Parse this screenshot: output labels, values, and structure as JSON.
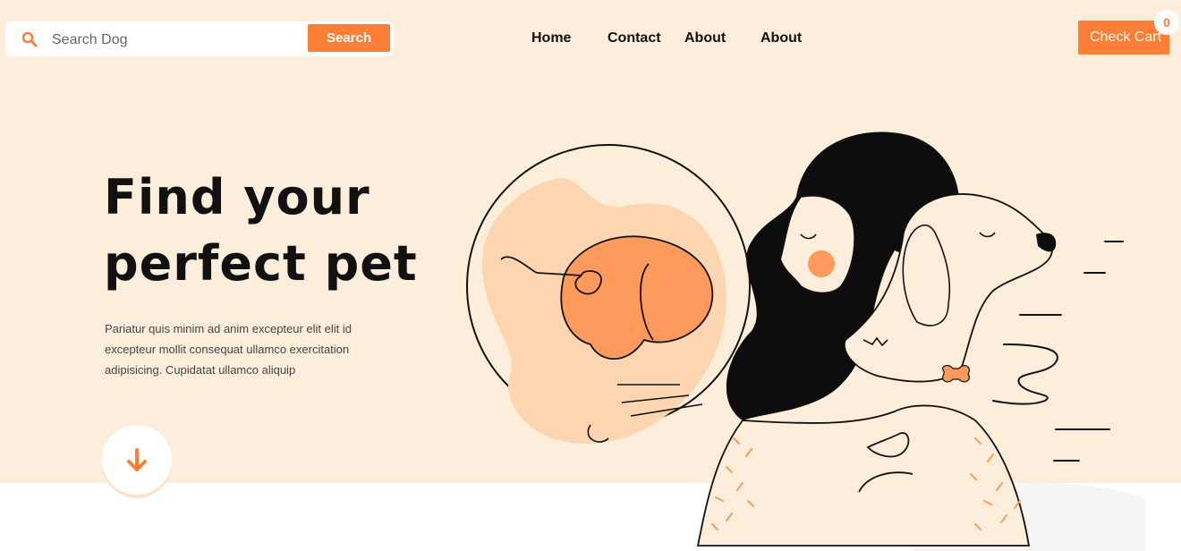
{
  "header": {
    "search": {
      "placeholder": "Search Dog",
      "button_label": "Search",
      "icon": "search-icon"
    },
    "nav": [
      {
        "label": "Home"
      },
      {
        "label": "Contact"
      },
      {
        "label": "About"
      },
      {
        "label": "About"
      }
    ],
    "cart": {
      "label": "Check Cart",
      "count": "0"
    }
  },
  "hero": {
    "headline_line1": "Find your",
    "headline_line2": "perfect pet",
    "description": "Pariatur quis minim ad anim excepteur elit elit id excepteur mollit consequat ullamco exercitation adipisicing. Cupidatat ullamco aliquip",
    "scroll_icon": "arrow-down-icon",
    "illustration": "woman-hugging-dog-illustration"
  },
  "colors": {
    "accent": "#fd7f35",
    "hero_background": "#fdeedb",
    "text": "#111111"
  }
}
